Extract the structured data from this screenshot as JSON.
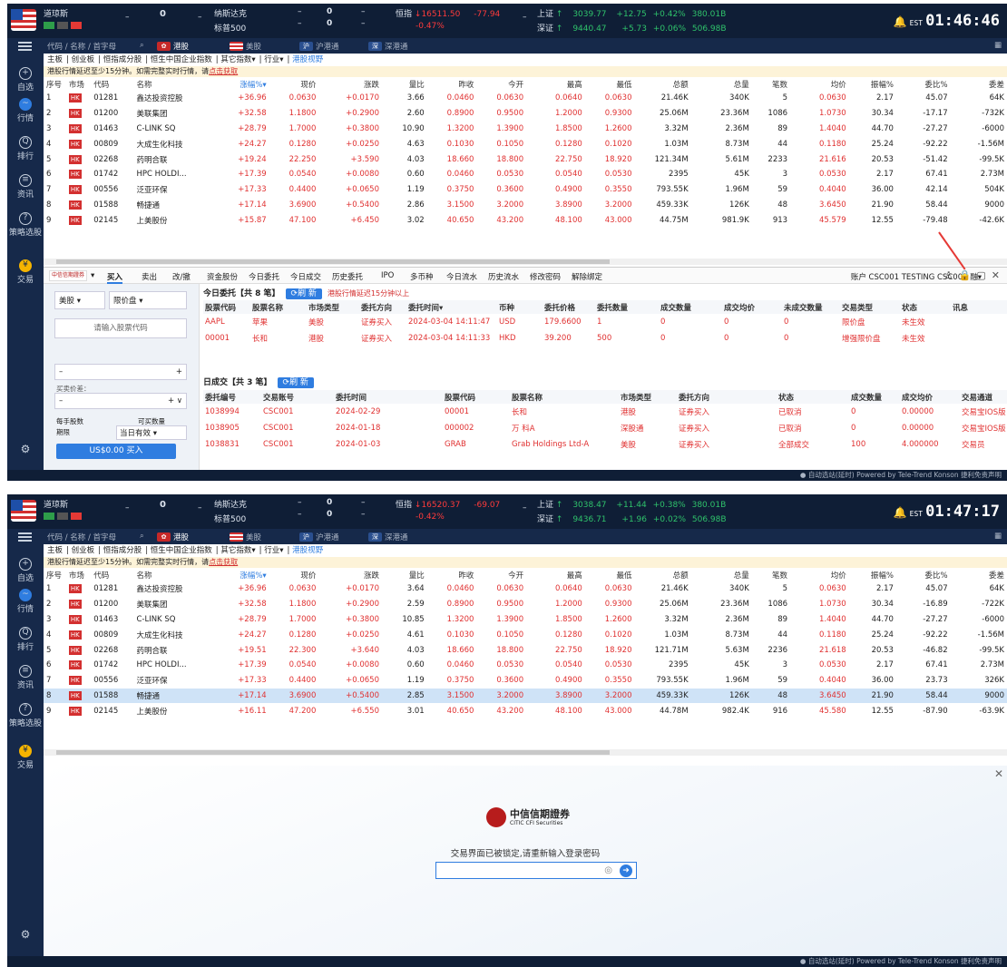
{
  "colors": {
    "up": "#e03131",
    "down": "#1a9e4b",
    "brand": "#2f7de0",
    "panel": "#16294a"
  },
  "ticker": {
    "dow_label": "道琼斯",
    "dow_value": "0",
    "dash": "–",
    "nasdaq_label": "纳斯达克",
    "sp_label": "标普500",
    "nasdaq_value": "0",
    "sp_value": "0",
    "hsi_label": "恒指",
    "sh_label": "上证",
    "sz_label": "深证",
    "est": "EST"
  },
  "screens": [
    {
      "hsi_value": "16511.50",
      "hsi_chg": "-77.94",
      "hsi_pct": "-0.47%",
      "sh_value": "3039.77",
      "sh_chg": "+12.75",
      "sh_pct": "+0.42%",
      "sh_amt": "380.01B",
      "sz_value": "9440.47",
      "sz_chg": "+5.73",
      "sz_pct": "+0.06%",
      "sz_amt": "506.98B",
      "clock": "01:46:46"
    },
    {
      "hsi_value": "16520.37",
      "hsi_chg": "-69.07",
      "hsi_pct": "-0.42%",
      "sh_value": "3038.47",
      "sh_chg": "+11.44",
      "sh_pct": "+0.38%",
      "sh_amt": "380.01B",
      "sz_value": "9436.71",
      "sz_chg": "+1.96",
      "sz_pct": "+0.02%",
      "sz_amt": "506.98B",
      "clock": "01:47:17"
    }
  ],
  "search": {
    "placeholder": "代码 / 名称 / 首字母"
  },
  "market_tabs": {
    "hk": "港股",
    "us": "美股",
    "sh": "沪港通",
    "sz": "深港通",
    "hk_badge": "港",
    "sh_badge": "沪",
    "sz_badge": "深"
  },
  "left_nav": {
    "fav": "自选",
    "quote": "行情",
    "rank": "排行",
    "news": "资讯",
    "strategy": "策略选股",
    "trade": "交易"
  },
  "sub_tabs": [
    "主板",
    "创业板",
    "恒指成分股",
    "恒生中国企业指数",
    "其它指数▾",
    "行业▾",
    "港股视野"
  ],
  "notice": {
    "text": "港股行情延迟至少15分钟。如需完整实时行情，请",
    "link": "点击获取"
  },
  "quote_headers": [
    "序号",
    "市场",
    "代码",
    "名称",
    "涨幅%▾",
    "现价",
    "涨跌",
    "量比",
    "昨收",
    "今开",
    "最高",
    "最低",
    "总额",
    "总量",
    "笔数",
    "均价",
    "振幅%",
    "委比%",
    "委差"
  ],
  "quotes1": [
    [
      "1",
      "01281",
      "鑫达投资控股",
      "+36.96",
      "0.0630",
      "+0.0170",
      "3.66",
      "0.0460",
      "0.0630",
      "0.0640",
      "0.0630",
      "21.46K",
      "340K",
      "5",
      "0.0630",
      "2.17",
      "45.07",
      "64K"
    ],
    [
      "2",
      "01200",
      "美联集团",
      "+32.58",
      "1.1800",
      "+0.2900",
      "2.60",
      "0.8900",
      "0.9500",
      "1.2000",
      "0.9300",
      "25.06M",
      "23.36M",
      "1086",
      "1.0730",
      "30.34",
      "-17.17",
      "-732K"
    ],
    [
      "3",
      "01463",
      "C-LINK SQ",
      "+28.79",
      "1.7000",
      "+0.3800",
      "10.90",
      "1.3200",
      "1.3900",
      "1.8500",
      "1.2600",
      "3.32M",
      "2.36M",
      "89",
      "1.4040",
      "44.70",
      "-27.27",
      "-6000"
    ],
    [
      "4",
      "00809",
      "大成生化科技",
      "+24.27",
      "0.1280",
      "+0.0250",
      "4.63",
      "0.1030",
      "0.1050",
      "0.1280",
      "0.1020",
      "1.03M",
      "8.73M",
      "44",
      "0.1180",
      "25.24",
      "-92.22",
      "-1.56M"
    ],
    [
      "5",
      "02268",
      "药明合联",
      "+19.24",
      "22.250",
      "+3.590",
      "4.03",
      "18.660",
      "18.800",
      "22.750",
      "18.920",
      "121.34M",
      "5.61M",
      "2233",
      "21.616",
      "20.53",
      "-51.42",
      "-99.5K"
    ],
    [
      "6",
      "01742",
      "HPC HOLDI...",
      "+17.39",
      "0.0540",
      "+0.0080",
      "0.60",
      "0.0460",
      "0.0530",
      "0.0540",
      "0.0530",
      "2395",
      "45K",
      "3",
      "0.0530",
      "2.17",
      "67.41",
      "2.73M"
    ],
    [
      "7",
      "00556",
      "泛亚环保",
      "+17.33",
      "0.4400",
      "+0.0650",
      "1.19",
      "0.3750",
      "0.3600",
      "0.4900",
      "0.3550",
      "793.55K",
      "1.96M",
      "59",
      "0.4040",
      "36.00",
      "42.14",
      "504K"
    ],
    [
      "8",
      "01588",
      "畅捷通",
      "+17.14",
      "3.6900",
      "+0.5400",
      "2.86",
      "3.1500",
      "3.2000",
      "3.8900",
      "3.2000",
      "459.33K",
      "126K",
      "48",
      "3.6450",
      "21.90",
      "58.44",
      "9000"
    ],
    [
      "9",
      "02145",
      "上美股份",
      "+15.87",
      "47.100",
      "+6.450",
      "3.02",
      "40.650",
      "43.200",
      "48.100",
      "43.000",
      "44.75M",
      "981.9K",
      "913",
      "45.579",
      "12.55",
      "-79.48",
      "-42.6K"
    ]
  ],
  "quotes2": [
    [
      "1",
      "01281",
      "鑫达投资控股",
      "+36.96",
      "0.0630",
      "+0.0170",
      "3.64",
      "0.0460",
      "0.0630",
      "0.0640",
      "0.0630",
      "21.46K",
      "340K",
      "5",
      "0.0630",
      "2.17",
      "45.07",
      "64K"
    ],
    [
      "2",
      "01200",
      "美联集团",
      "+32.58",
      "1.1800",
      "+0.2900",
      "2.59",
      "0.8900",
      "0.9500",
      "1.2000",
      "0.9300",
      "25.06M",
      "23.36M",
      "1086",
      "1.0730",
      "30.34",
      "-16.89",
      "-722K"
    ],
    [
      "3",
      "01463",
      "C-LINK SQ",
      "+28.79",
      "1.7000",
      "+0.3800",
      "10.85",
      "1.3200",
      "1.3900",
      "1.8500",
      "1.2600",
      "3.32M",
      "2.36M",
      "89",
      "1.4040",
      "44.70",
      "-27.27",
      "-6000"
    ],
    [
      "4",
      "00809",
      "大成生化科技",
      "+24.27",
      "0.1280",
      "+0.0250",
      "4.61",
      "0.1030",
      "0.1050",
      "0.1280",
      "0.1020",
      "1.03M",
      "8.73M",
      "44",
      "0.1180",
      "25.24",
      "-92.22",
      "-1.56M"
    ],
    [
      "5",
      "02268",
      "药明合联",
      "+19.51",
      "22.300",
      "+3.640",
      "4.03",
      "18.660",
      "18.800",
      "22.750",
      "18.920",
      "121.71M",
      "5.63M",
      "2236",
      "21.618",
      "20.53",
      "-46.82",
      "-99.5K"
    ],
    [
      "6",
      "01742",
      "HPC HOLDI...",
      "+17.39",
      "0.0540",
      "+0.0080",
      "0.60",
      "0.0460",
      "0.0530",
      "0.0540",
      "0.0530",
      "2395",
      "45K",
      "3",
      "0.0530",
      "2.17",
      "67.41",
      "2.73M"
    ],
    [
      "7",
      "00556",
      "泛亚环保",
      "+17.33",
      "0.4400",
      "+0.0650",
      "1.19",
      "0.3750",
      "0.3600",
      "0.4900",
      "0.3550",
      "793.55K",
      "1.96M",
      "59",
      "0.4040",
      "36.00",
      "23.73",
      "326K"
    ],
    [
      "8",
      "01588",
      "畅捷通",
      "+17.14",
      "3.6900",
      "+0.5400",
      "2.85",
      "3.1500",
      "3.2000",
      "3.8900",
      "3.2000",
      "459.33K",
      "126K",
      "48",
      "3.6450",
      "21.90",
      "58.44",
      "9000"
    ],
    [
      "9",
      "02145",
      "上美股份",
      "+16.11",
      "47.200",
      "+6.550",
      "3.01",
      "40.650",
      "43.200",
      "48.100",
      "43.000",
      "44.78M",
      "982.4K",
      "916",
      "45.580",
      "12.55",
      "-87.90",
      "-63.9K"
    ]
  ],
  "market_badge": "HK",
  "trade_tabs": [
    "买入",
    "卖出",
    "改/撤",
    "资金股份",
    "今日委托",
    "今日成交",
    "历史委托",
    "IPO",
    "多币种",
    "今日流水",
    "历史流水",
    "修改密码",
    "解除绑定"
  ],
  "broker_small": "中信信期證券",
  "account": "账户 CSC001 TESTING CSC001 融▾",
  "form": {
    "market": "美股 ▾",
    "price_type": "限价盘 ▾",
    "code_placeholder": "请输入股票代码",
    "price_minus": "–",
    "price_plus": "+",
    "qty_label": "买卖价差：",
    "qty_minus": "–",
    "qty_plus": "+  ∨",
    "lot_label": "每手股数",
    "avail_label": "可买数量",
    "period_label": "期限",
    "period_value": "当日有效 ▾",
    "buy_btn": "US$0.00  买入"
  },
  "orders": {
    "title": "今日委托【共 8 笔】",
    "refresh": "⟳刷 新",
    "warn": "港股行情延迟15分钟以上",
    "headers": [
      "股票代码",
      "股票名称",
      "市场类型",
      "委托方向",
      "委托时间▾",
      "币种",
      "委托价格",
      "委托数量",
      "成交数量",
      "成交均价",
      "未成交数量",
      "交易类型",
      "状态",
      "讯息"
    ],
    "rows": [
      [
        "AAPL",
        "苹果",
        "美股",
        "证券买入",
        "2024-03-04 14:11:47",
        "USD",
        "179.6600",
        "1",
        "0",
        "0",
        "0",
        "限价盘",
        "未生效",
        ""
      ],
      [
        "00001",
        "长和",
        "港股",
        "证券买入",
        "2024-03-04 14:11:33",
        "HKD",
        "39.200",
        "500",
        "0",
        "0",
        "0",
        "增强限价盘",
        "未生效",
        ""
      ]
    ]
  },
  "deals": {
    "title": "日成交【共 3 笔】",
    "refresh": "⟳刷 新",
    "headers": [
      "委托编号",
      "交易账号",
      "委托时间",
      "股票代码",
      "股票名称",
      "市场类型",
      "委托方向",
      "状态",
      "成交数量",
      "成交均价",
      "交易通道"
    ],
    "rows": [
      [
        "1038994",
        "CSC001",
        "2024-02-29",
        "00001",
        "长和",
        "港股",
        "证券买入",
        "已取消",
        "0",
        "0.00000",
        "交易宝IOS版"
      ],
      [
        "1038905",
        "CSC001",
        "2024-01-18",
        "000002",
        "万 科A",
        "深股通",
        "证券买入",
        "已取消",
        "0",
        "0.00000",
        "交易宝IOS版"
      ],
      [
        "1038831",
        "CSC001",
        "2024-01-03",
        "GRAB",
        "Grab Holdings Ltd-A",
        "美股",
        "证券买入",
        "全部成交",
        "100",
        "4.000000",
        "交易员"
      ]
    ]
  },
  "footer": "● 自动选站(延时)  Powered by Tele-Trend Konson   捷利免责声明",
  "lock": {
    "brand_cn": "中信信期證券",
    "brand_en": "CITIC CFI Securities",
    "message": "交易界面已被锁定,请重新输入登录密码",
    "placeholder": ""
  }
}
